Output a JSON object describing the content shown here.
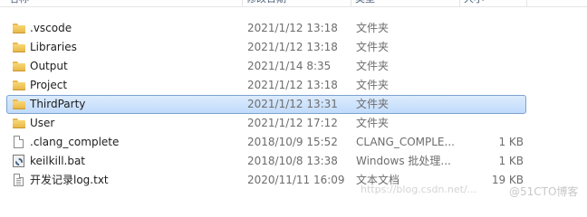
{
  "header": {
    "name": "名称",
    "date_modified": "修改日期",
    "type": "类型",
    "size": "大小"
  },
  "files": [
    {
      "name": ".vscode",
      "date": "2021/1/12 13:18",
      "type": "文件夹",
      "size": "",
      "icon": "folder-icon",
      "selected": false
    },
    {
      "name": "Libraries",
      "date": "2021/1/12 13:18",
      "type": "文件夹",
      "size": "",
      "icon": "folder-icon",
      "selected": false
    },
    {
      "name": "Output",
      "date": "2021/1/14 8:35",
      "type": "文件夹",
      "size": "",
      "icon": "folder-icon",
      "selected": false
    },
    {
      "name": "Project",
      "date": "2021/1/12 13:18",
      "type": "文件夹",
      "size": "",
      "icon": "folder-icon",
      "selected": false
    },
    {
      "name": "ThirdParty",
      "date": "2021/1/12 13:31",
      "type": "文件夹",
      "size": "",
      "icon": "folder-icon",
      "selected": true
    },
    {
      "name": "User",
      "date": "2021/1/12 17:12",
      "type": "文件夹",
      "size": "",
      "icon": "folder-icon",
      "selected": false
    },
    {
      "name": ".clang_complete",
      "date": "2018/10/9 15:52",
      "type": "CLANG_COMPLE...",
      "size": "1 KB",
      "icon": "file-icon",
      "selected": false
    },
    {
      "name": "keilkill.bat",
      "date": "2018/10/8 13:38",
      "type": "Windows 批处理...",
      "size": "1 KB",
      "icon": "batch-file-icon",
      "selected": false
    },
    {
      "name": "开发记录log.txt",
      "date": "2020/11/11 16:09",
      "type": "文本文档",
      "size": "19 KB",
      "icon": "text-file-icon",
      "selected": false
    }
  ],
  "watermark": {
    "url": "https://blog.csdn.net/...",
    "brand": "@51CTO博客"
  },
  "colors": {
    "selection_fill": "#cce4fc",
    "selection_border": "#7da2ce",
    "folder": "#f0c75e",
    "secondary_text": "#6d6d6d"
  }
}
